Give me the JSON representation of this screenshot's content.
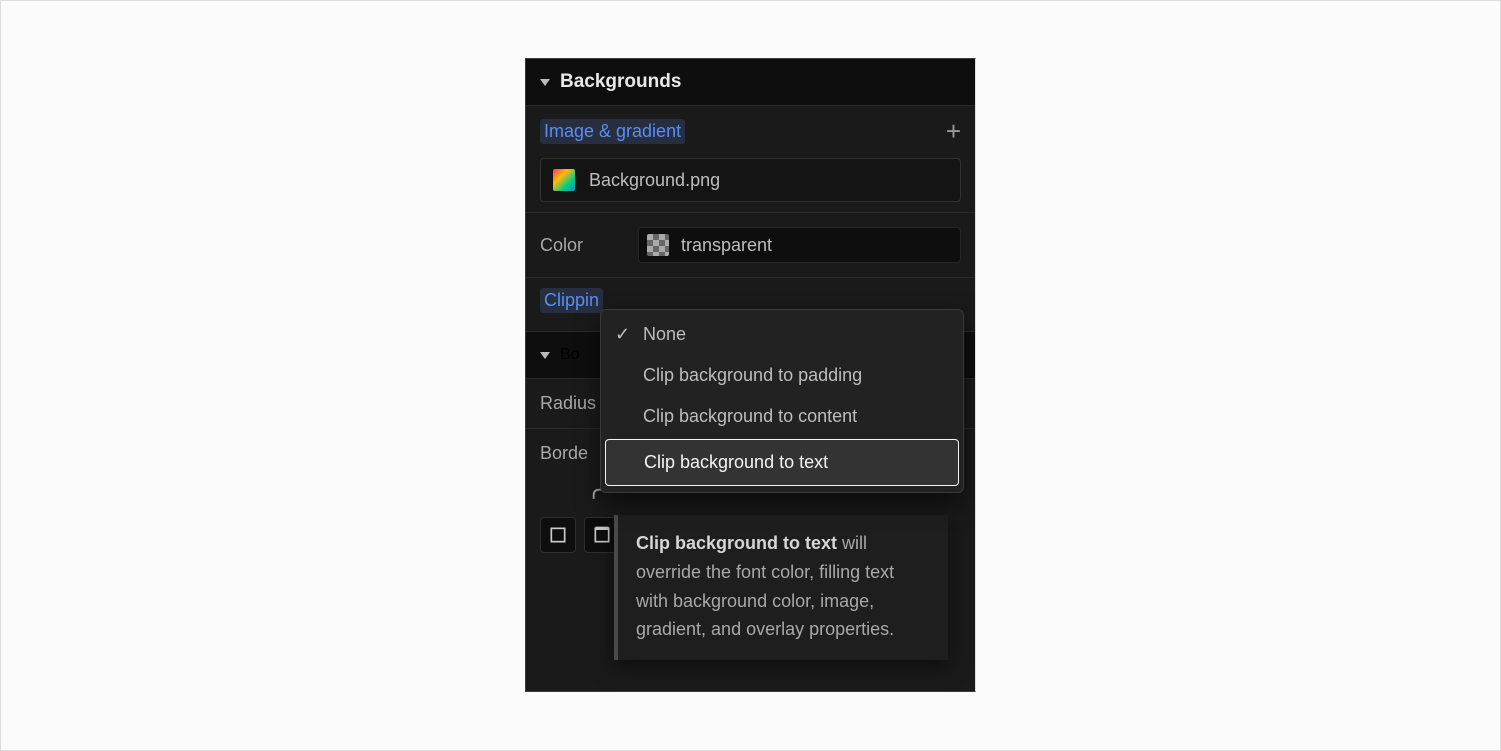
{
  "backgrounds": {
    "title": "Backgrounds",
    "image_gradient_label": "Image & gradient",
    "file_name": "Background.png",
    "color_label": "Color",
    "color_value": "transparent",
    "clipping_label": "Clippin"
  },
  "borders": {
    "title_visible": "Bo",
    "radius_label": "Radius",
    "border_label": "Borde"
  },
  "clip_menu": {
    "items": [
      {
        "label": "None",
        "checked": true
      },
      {
        "label": "Clip background to padding",
        "checked": false
      },
      {
        "label": "Clip background to content",
        "checked": false
      },
      {
        "label": "Clip background to text",
        "checked": false,
        "highlight": true
      }
    ],
    "tooltip_bold": "Clip background to text",
    "tooltip_rest": " will override the font color, filling text with background color, image, gradient, and overlay properties."
  }
}
